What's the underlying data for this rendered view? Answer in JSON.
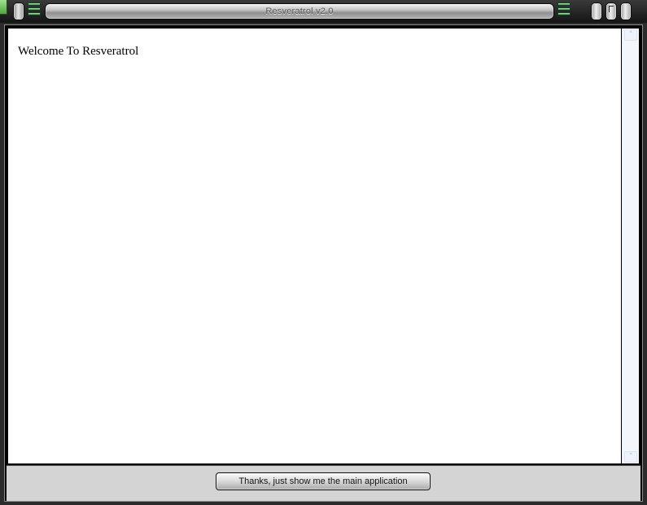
{
  "window": {
    "title": "Resveratrol v2.0"
  },
  "content": {
    "welcome_text": "Welcome To Resveratrol"
  },
  "footer": {
    "main_button_label": "Thanks, just show me the main application"
  },
  "icons": {
    "scroll_up": "˄",
    "scroll_down": "˅"
  },
  "colors": {
    "accent_green": "#5fbf4f",
    "title_text": "#565656"
  }
}
